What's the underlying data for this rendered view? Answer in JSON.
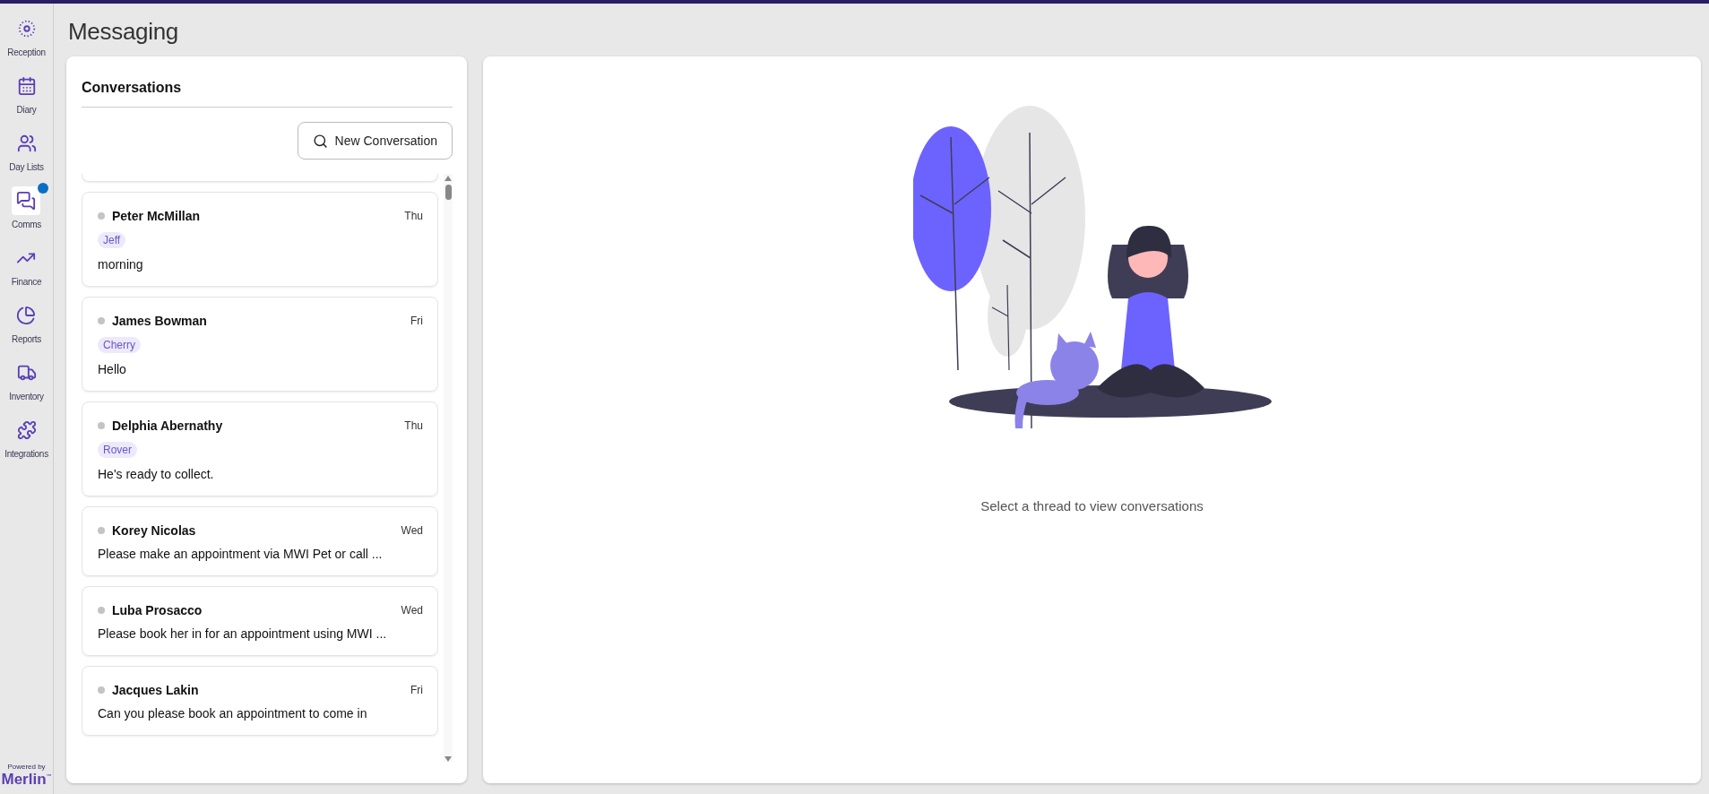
{
  "nav": {
    "items": [
      {
        "label": "Reception",
        "selected": false,
        "badge": false
      },
      {
        "label": "Diary",
        "selected": false,
        "badge": false
      },
      {
        "label": "Day Lists",
        "selected": false,
        "badge": false
      },
      {
        "label": "Comms",
        "selected": true,
        "badge": true
      },
      {
        "label": "Finance",
        "selected": false,
        "badge": false
      },
      {
        "label": "Reports",
        "selected": false,
        "badge": false
      },
      {
        "label": "Inventory",
        "selected": false,
        "badge": false
      },
      {
        "label": "Integrations",
        "selected": false,
        "badge": false
      }
    ],
    "powered_by": "Powered by",
    "brand": "Merlin",
    "brand_mark": "™"
  },
  "page_title": "Messaging",
  "conversations": {
    "title": "Conversations",
    "new_button": "New Conversation",
    "items": [
      {
        "name": "Peter McMillan",
        "day": "Thu",
        "pet": "Jeff",
        "preview": "morning"
      },
      {
        "name": "James Bowman",
        "day": "Fri",
        "pet": "Cherry",
        "preview": "Hello"
      },
      {
        "name": "Delphia Abernathy",
        "day": "Thu",
        "pet": "Rover",
        "preview": "He's ready to collect."
      },
      {
        "name": "Korey Nicolas",
        "day": "Wed",
        "preview": "Please make an appointment via MWI Pet or call ..."
      },
      {
        "name": "Luba Prosacco",
        "day": "Wed",
        "preview": "Please book her in for an appointment using MWI ..."
      },
      {
        "name": "Jacques Lakin",
        "day": "Fri",
        "preview": "Can you please book an appointment to come in"
      }
    ]
  },
  "empty_state": {
    "message": "Select a thread to view conversations"
  }
}
